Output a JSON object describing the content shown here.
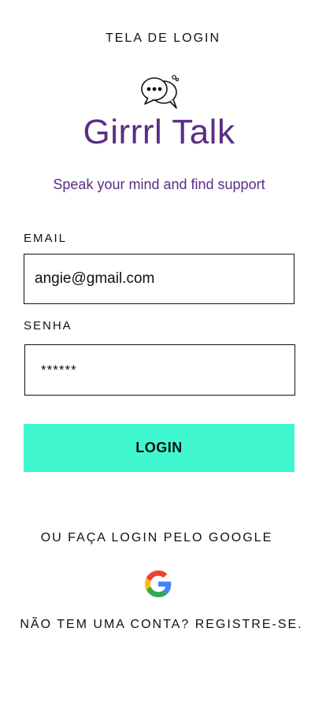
{
  "screen": {
    "title": "TELA DE LOGIN"
  },
  "brand": {
    "logo_icon": "chat-bubbles-icon",
    "name": "Girrrl Talk",
    "tagline": "Speak your mind and find support",
    "color": "#5b2d86"
  },
  "form": {
    "email_label": "EMAIL",
    "email_value": "angie@gmail.com",
    "password_label": "SENHA",
    "password_value": "******",
    "login_button": "LOGIN",
    "login_button_color": "#40f7cf"
  },
  "alt_login": {
    "google_hint": "OU FAÇA LOGIN PELO GOOGLE",
    "google_icon": "google-g-icon"
  },
  "footer": {
    "register_link": "NÃO TEM UMA CONTA? REGISTRE-SE."
  }
}
